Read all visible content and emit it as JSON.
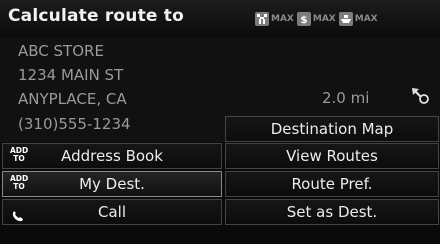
{
  "header": {
    "title": "Calculate route to",
    "prefs": [
      {
        "icon": "highway-icon",
        "label": "MAX"
      },
      {
        "icon": "toll-icon",
        "label": "MAX"
      },
      {
        "icon": "ferry-icon",
        "label": "MAX"
      }
    ]
  },
  "destination": {
    "name": "ABC STORE",
    "street": "1234 MAIN ST",
    "city": "ANYPLACE, CA",
    "phone": "(310)555-1234",
    "distance": "2.0 mi",
    "direction_icon": "direction-arrow-icon"
  },
  "buttons": {
    "destination_map": "Destination Map",
    "view_routes": "View Routes",
    "route_pref": "Route Pref.",
    "set_as_dest": "Set as Dest.",
    "address_book": "Address Book",
    "my_dest": "My Dest.",
    "call": "Call",
    "add_to": "ADD TO"
  },
  "colors": {
    "background": "#0a0a0a",
    "text": "#e8e8e8",
    "muted_text": "#9a9a9a",
    "button_border": "#444444",
    "icon_grey": "#7d7d7d"
  }
}
